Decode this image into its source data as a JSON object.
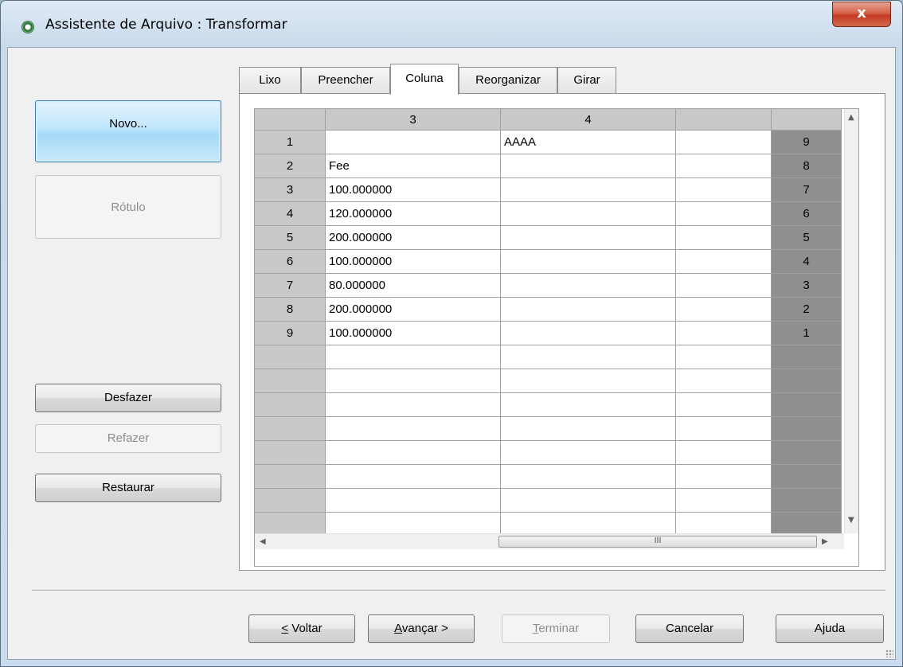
{
  "window": {
    "title": "Assistente de Arquivo : Transformar",
    "close_label": "x"
  },
  "left_buttons": {
    "novo": "Novo...",
    "rotulo": "Rótulo",
    "desfazer": "Desfazer",
    "refazer": "Refazer",
    "restaurar": "Restaurar"
  },
  "tabs": [
    {
      "label": "Lixo",
      "active": false
    },
    {
      "label": "Preencher",
      "active": false
    },
    {
      "label": "Coluna",
      "active": true
    },
    {
      "label": "Reorganizar",
      "active": false
    },
    {
      "label": "Girar",
      "active": false
    }
  ],
  "grid": {
    "columns": [
      "3",
      "4",
      ""
    ],
    "rows": [
      {
        "n": "1",
        "c3": "",
        "c4": "AAAA",
        "c5": "",
        "rev": "9"
      },
      {
        "n": "2",
        "c3": "Fee",
        "c4": "",
        "c5": "",
        "rev": "8"
      },
      {
        "n": "3",
        "c3": "100.000000",
        "c4": "",
        "c5": "",
        "rev": "7"
      },
      {
        "n": "4",
        "c3": "120.000000",
        "c4": "",
        "c5": "",
        "rev": "6"
      },
      {
        "n": "5",
        "c3": "200.000000",
        "c4": "",
        "c5": "",
        "rev": "5"
      },
      {
        "n": "6",
        "c3": "100.000000",
        "c4": "",
        "c5": "",
        "rev": "4"
      },
      {
        "n": "7",
        "c3": "80.000000",
        "c4": "",
        "c5": "",
        "rev": "3"
      },
      {
        "n": "8",
        "c3": "200.000000",
        "c4": "",
        "c5": "",
        "rev": "2"
      },
      {
        "n": "9",
        "c3": "100.000000",
        "c4": "",
        "c5": "",
        "rev": "1"
      }
    ],
    "empty_rows": 8,
    "scroll_grip": "III"
  },
  "bottom_buttons": {
    "voltar_prefix": "<",
    "voltar_rest": " Voltar",
    "avancar_first": "A",
    "avancar_rest": "vançar >",
    "terminar_first": "T",
    "terminar_rest": "erminar",
    "cancelar": "Cancelar",
    "ajuda_prefix": "A",
    "ajuda_mid": "j",
    "ajuda_rest": "uda"
  }
}
